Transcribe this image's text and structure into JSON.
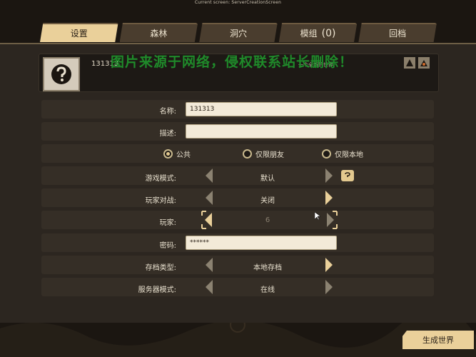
{
  "screen_title": "Current screen: ServerCreationScreen",
  "tabs": [
    {
      "label": "设置",
      "count": ""
    },
    {
      "label": "森林",
      "count": ""
    },
    {
      "label": "洞穴",
      "count": ""
    },
    {
      "label": "模组",
      "count": "(0)"
    },
    {
      "label": "回档",
      "count": ""
    }
  ],
  "header": {
    "server_name": "131313",
    "server_description": "一个全新的世界",
    "watermark": "图片来源于网络，侵权联系站长删除！"
  },
  "form": {
    "name_label": "名称:",
    "name_value": "131313",
    "desc_label": "描述:",
    "desc_value": "",
    "privacy": {
      "options": [
        "公共",
        "仅限朋友",
        "仅限本地"
      ],
      "selected": "公共"
    },
    "game_mode": {
      "label": "游戏模式:",
      "value": "默认"
    },
    "pvp": {
      "label": "玩家对战:",
      "value": "关闭"
    },
    "players": {
      "label": "玩家:",
      "value": "6"
    },
    "password": {
      "label": "密码:",
      "value": "******"
    },
    "save_type": {
      "label": "存档类型:",
      "value": "本地存档"
    },
    "server_mode": {
      "label": "服务器模式:",
      "value": "在线"
    }
  },
  "footer": {
    "generate_label": "生成世界"
  },
  "colors": {
    "accent": "#ead09a",
    "panel": "#2c2620",
    "watermark": "#1f8a2a"
  }
}
